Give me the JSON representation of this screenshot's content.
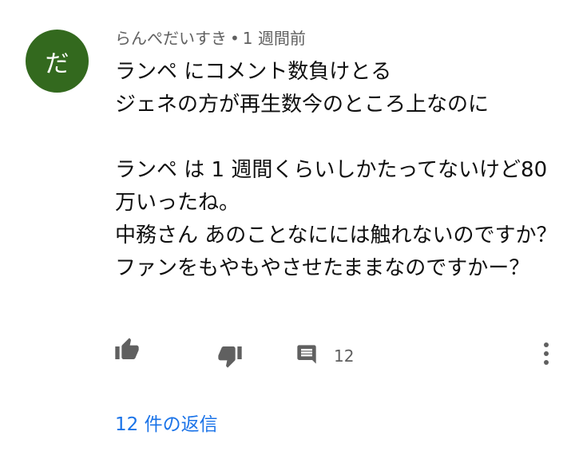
{
  "comment": {
    "avatar_initial": "だ",
    "avatar_color": "#33691e",
    "author": "らんぺだいすき",
    "separator": "•",
    "timestamp": "1 週間前",
    "text": "ランペ にコメント数負けとる\nジェネの方が再生数今のところ上なのに\n\nランペ は 1 週間くらいしかたってないけど80万いったね。\n中務さん あのことなにには触れないのですか？ファンをもやもやさせたままなのですかー？",
    "reply_count": "12",
    "replies_link": "12 件の返信",
    "accent_color": "#1a73e8"
  },
  "icons": {
    "like": "thumb-up-icon",
    "dislike": "thumb-down-icon",
    "reply": "comment-icon",
    "more": "more-vertical-icon"
  }
}
